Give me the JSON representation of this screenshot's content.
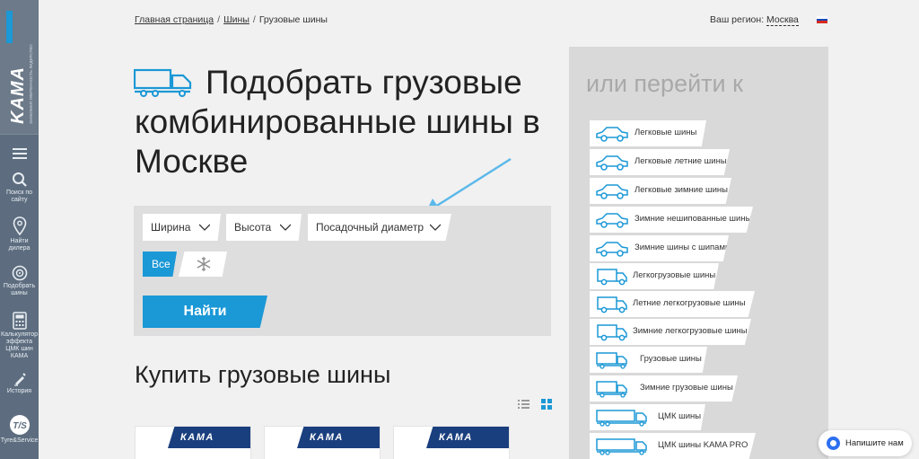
{
  "brand": {
    "name": "KAMA",
    "tagline": "ЗНАКОМАЯ УВЕРЕННОСТЬ ЛИДЕРСТВО"
  },
  "sidebar": {
    "items": [
      {
        "label": "",
        "icon": "menu-icon"
      },
      {
        "label": "Поиск по сайту",
        "icon": "search-icon"
      },
      {
        "label": "Найти дилера",
        "icon": "map-pin-icon"
      },
      {
        "label": "Подобрать шины",
        "icon": "tire-icon"
      },
      {
        "label": "Калькулятор эффекта ЦМК шин КАМА",
        "icon": "calculator-icon"
      },
      {
        "label": "История",
        "icon": "history-icon"
      },
      {
        "label": "Tyre&Service",
        "icon": "tyre-service-icon"
      }
    ]
  },
  "breadcrumb": {
    "home": "Главная страница",
    "tires": "Шины",
    "current": "Грузовые шины",
    "separator": "/"
  },
  "region": {
    "label": "Ваш регион:",
    "city": "Москва"
  },
  "page_title": "Подобрать грузовые комбинированные шины в Москве",
  "filter": {
    "width_label": "Ширина",
    "height_label": "Высота",
    "diameter_label": "Посадочный диаметр",
    "season_all": "Все",
    "find_button": "Найти",
    "accent": "#1b98d6"
  },
  "buy": {
    "title": "Купить грузовые шины",
    "cards": [
      {
        "brand": "КАМА"
      },
      {
        "brand": "КАМА"
      },
      {
        "brand": "КАМА"
      }
    ]
  },
  "goto": {
    "title": "или перейти к",
    "items": [
      {
        "label": "Легковые шины",
        "icon": "car-icon"
      },
      {
        "label": "Легковые летние шины",
        "icon": "car-icon"
      },
      {
        "label": "Легковые зимние шины",
        "icon": "car-icon"
      },
      {
        "label": "Зимние нешипованные шины",
        "icon": "car-icon"
      },
      {
        "label": "Зимние шины с шипами",
        "icon": "car-icon"
      },
      {
        "label": "Легкогрузовые шины",
        "icon": "van-icon"
      },
      {
        "label": "Летние легкогрузовые шины",
        "icon": "van-icon"
      },
      {
        "label": "Зимние легкогрузовые шины",
        "icon": "van-icon"
      },
      {
        "label": "Грузовые шины",
        "icon": "truck-icon"
      },
      {
        "label": "Зимние грузовые шины",
        "icon": "truck-icon"
      },
      {
        "label": "ЦМК шины",
        "icon": "long-truck-icon"
      },
      {
        "label": "ЦМК шины KAMA PRO",
        "icon": "long-truck-icon"
      }
    ]
  },
  "chat": {
    "label": "Напишите нам"
  }
}
